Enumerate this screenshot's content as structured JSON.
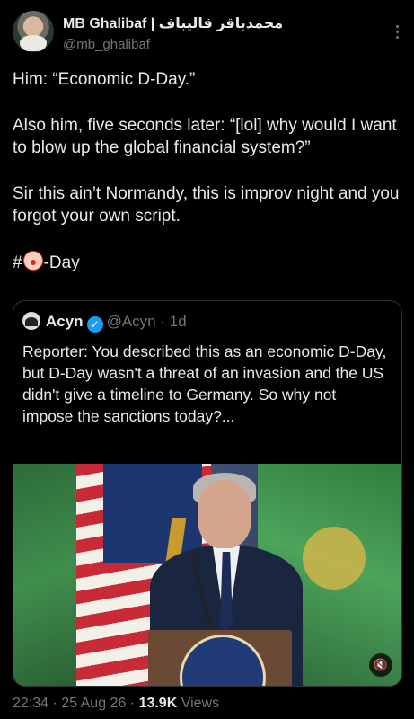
{
  "author": {
    "display_name": "MB Ghalibaf | محمدباقر قالیباف",
    "handle": "@mb_ghalibaf"
  },
  "tweet": {
    "paragraphs": [
      "Him: “Economic D-Day.”",
      "Also him, five seconds later: “[lol] why would I want to blow up the global financial system?”",
      "Sir this ain’t Normandy, this is improv night and you forgot your own script."
    ],
    "hashtag_prefix": "#",
    "hashtag_suffix": "-Day"
  },
  "quoted": {
    "name": "Acyn",
    "handle": "@Acyn",
    "separator": "·",
    "age": "1d",
    "text": "Reporter: You described this as an economic D-Day, but D-Day wasn't a threat of an invasion and the US didn't give a timeline to Germany. So why not impose the sanctions today?...",
    "verified_icon": "✓",
    "mute_icon": "🔇"
  },
  "meta": {
    "time": "22:34",
    "sep1": " · ",
    "date": "25 Aug 26",
    "sep2": " · ",
    "views_count": "13.9K",
    "views_label": " Views"
  },
  "icons": {
    "more": "more-dots-icon",
    "clown": "clown-face-icon"
  },
  "colors": {
    "background": "#000000",
    "text": "#e7e9ea",
    "secondary": "#71767b",
    "verified": "#1d9bf0",
    "border": "#2f3336"
  }
}
